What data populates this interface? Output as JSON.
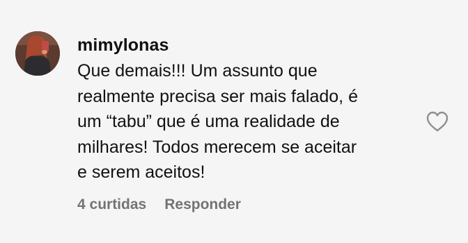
{
  "comment": {
    "username": "mimylonas",
    "lines": [
      "Que demais!!! Um assunto que",
      "realmente precisa ser mais falado, é",
      "um “tabu” que é uma realidade de",
      "milhares! Todos merecem se aceitar",
      "e serem aceitos!"
    ],
    "likes_label": "4 curtidas",
    "reply_label": "Responder"
  },
  "icons": {
    "like": "heart-outline-icon",
    "avatar": "user-avatar"
  },
  "colors": {
    "background": "#f5f5f5",
    "text": "#111111",
    "secondary": "#737373"
  }
}
